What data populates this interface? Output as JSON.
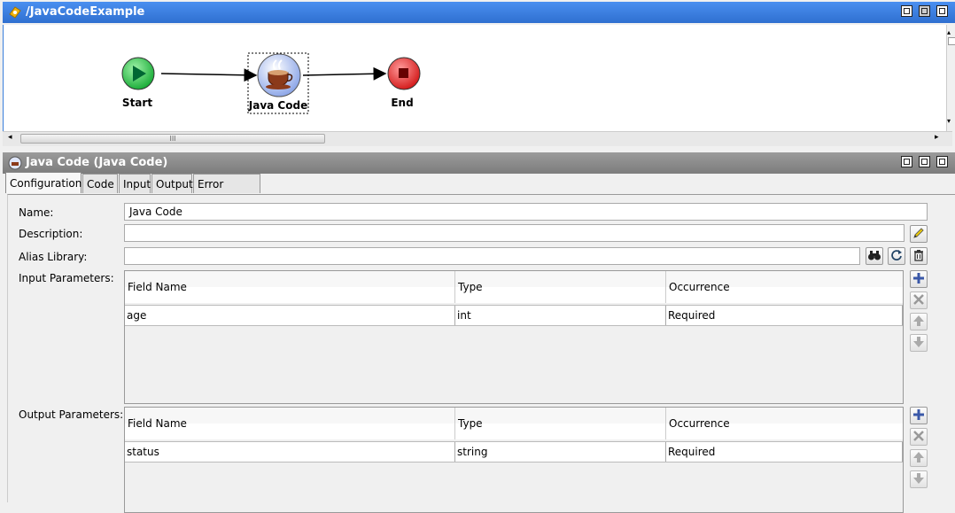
{
  "process": {
    "title": "/JavaCodeExample",
    "nodes": {
      "start": "Start",
      "java_code": "Java Code",
      "end": "End"
    },
    "scroll_grip": "III"
  },
  "properties": {
    "title": "Java Code (Java Code)",
    "tabs": [
      "Configuration",
      "Code",
      "Input",
      "Output",
      "Error Output"
    ],
    "fields": {
      "name_label": "Name:",
      "name_value": "Java Code",
      "description_label": "Description:",
      "description_value": "",
      "alias_label": "Alias Library:",
      "alias_value": ""
    },
    "input_parameters": {
      "label": "Input Parameters:",
      "columns": [
        "Field Name",
        "Type",
        "Occurrence"
      ],
      "rows": [
        [
          "age",
          "int",
          "Required"
        ]
      ]
    },
    "output_parameters": {
      "label": "Output Parameters:",
      "columns": [
        "Field Name",
        "Type",
        "Occurrence"
      ],
      "rows": [
        [
          "status",
          "string",
          "Required"
        ]
      ]
    }
  },
  "colors": {
    "active_titlebar": "#3a7fdc",
    "inactive_titlebar": "#8a8a8a",
    "start_node": "#2ecc40",
    "end_node": "#e03030"
  }
}
